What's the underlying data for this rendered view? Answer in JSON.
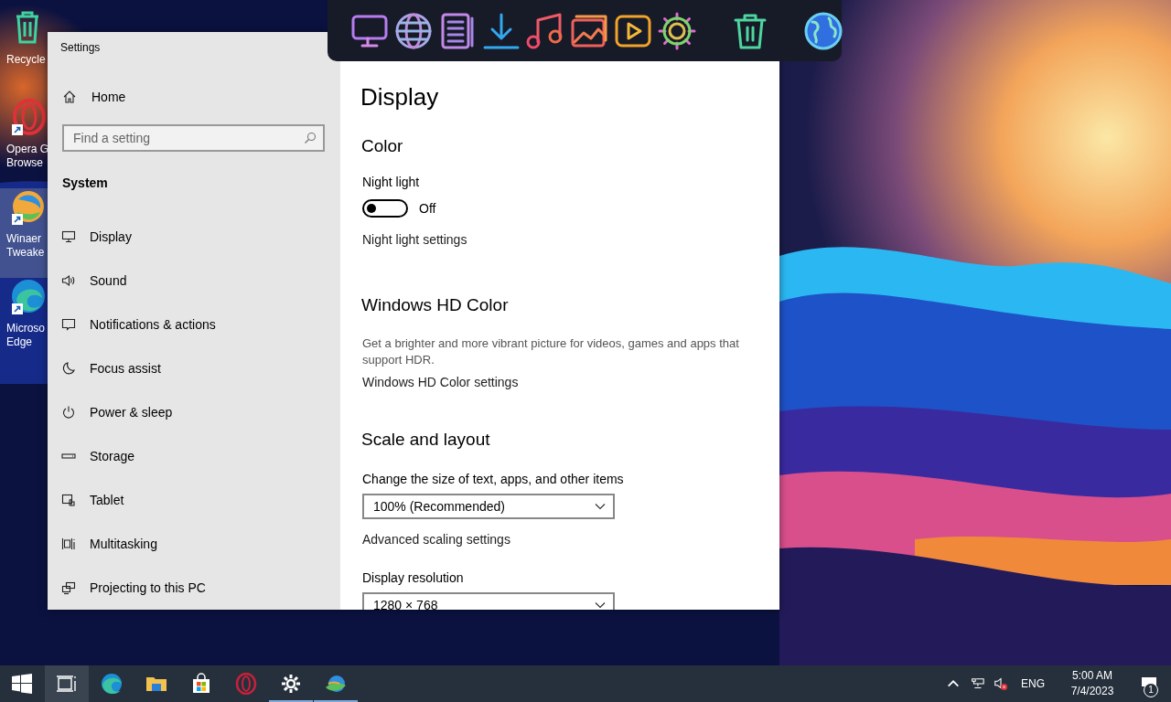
{
  "desktop_icons": [
    {
      "kind": "recycle",
      "shortcut": false,
      "selected": false,
      "lines": [
        "Recycle"
      ]
    },
    {
      "kind": "opera",
      "shortcut": true,
      "selected": false,
      "lines": [
        "Opera G",
        "Browse"
      ]
    },
    {
      "kind": "winaero",
      "shortcut": true,
      "selected": true,
      "lines": [
        "Winaer",
        "Tweake"
      ]
    },
    {
      "kind": "edge",
      "shortcut": true,
      "selected": false,
      "lines": [
        "Microso",
        "Edge"
      ]
    }
  ],
  "window": {
    "title": "Settings"
  },
  "sidebar": {
    "home": "Home",
    "search": {
      "placeholder": "Find a setting"
    },
    "heading": "System",
    "items": [
      {
        "kind": "display",
        "label": "Display"
      },
      {
        "kind": "sound",
        "label": "Sound"
      },
      {
        "kind": "notifications",
        "label": "Notifications & actions"
      },
      {
        "kind": "focus",
        "label": "Focus assist"
      },
      {
        "kind": "power",
        "label": "Power & sleep"
      },
      {
        "kind": "storage",
        "label": "Storage"
      },
      {
        "kind": "tablet",
        "label": "Tablet"
      },
      {
        "kind": "multitasking",
        "label": "Multitasking"
      },
      {
        "kind": "projecting",
        "label": "Projecting to this PC"
      }
    ]
  },
  "content": {
    "title": "Display",
    "color": {
      "heading": "Color",
      "night_light": {
        "label": "Night light",
        "on": false,
        "state_text": "Off"
      },
      "link": "Night light settings"
    },
    "hd_color": {
      "heading": "Windows HD Color",
      "description": "Get a brighter and more vibrant picture for videos, games and apps that support HDR.",
      "link": "Windows HD Color settings"
    },
    "scale": {
      "heading": "Scale and layout",
      "size_label": "Change the size of text, apps, and other items",
      "size_value": "100% (Recommended)",
      "link": "Advanced scaling settings",
      "resolution_label": "Display resolution",
      "resolution_value": "1280 × 768"
    }
  },
  "taskbar": {
    "apps": [
      {
        "kind": "start",
        "selected": false,
        "running": false
      },
      {
        "kind": "taskview",
        "selected": true,
        "running": false
      },
      {
        "kind": "edge",
        "selected": false,
        "running": false
      },
      {
        "kind": "explorer",
        "selected": false,
        "running": false
      },
      {
        "kind": "store",
        "selected": false,
        "running": false
      },
      {
        "kind": "opera",
        "selected": false,
        "running": false
      },
      {
        "kind": "settings",
        "selected": false,
        "running": true
      },
      {
        "kind": "winaero",
        "selected": false,
        "running": true
      }
    ],
    "language": "ENG",
    "time": "5:00 AM",
    "date": "7/4/2023",
    "notification_count": "1"
  }
}
